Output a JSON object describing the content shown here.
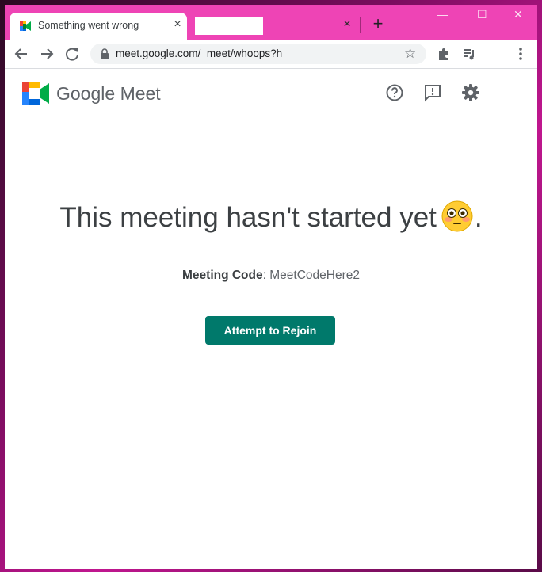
{
  "browser": {
    "tabs": [
      {
        "title": "Something went wrong",
        "favicon": "google-meet-favicon"
      },
      {
        "title": ""
      }
    ],
    "tab_close": "×",
    "new_tab": "+",
    "url": "meet.google.com/_meet/whoops?h",
    "window_controls": {
      "minimize": "—",
      "maximize": "☐",
      "close": "✕"
    }
  },
  "header": {
    "brand_google": "Google",
    "brand_product": "Meet",
    "icons": [
      "help-icon",
      "feedback-icon",
      "settings-icon"
    ]
  },
  "main": {
    "headline": "This meeting hasn't started yet",
    "headline_suffix": ".",
    "emoji": "flushed-face",
    "code_label": "Meeting Code",
    "code_separator": ": ",
    "code_value": "MeetCodeHere2",
    "button_label": "Attempt to Rejoin"
  },
  "colors": {
    "tabstrip": "#ee44b5",
    "button": "#00796b",
    "text": "#3c4043"
  }
}
